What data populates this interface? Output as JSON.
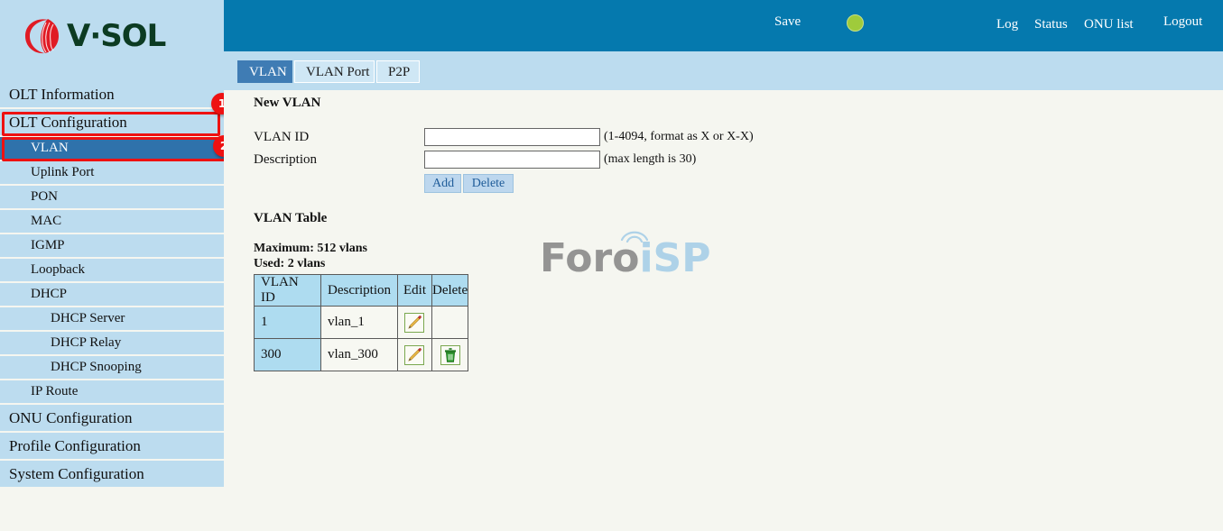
{
  "brand": {
    "logo_text": "V·SOL",
    "logo_mark_icon": "vsol-swoosh-icon",
    "logo_mark_color": "#e01b24",
    "logo_text_color": "#0c3b22"
  },
  "topbar": {
    "background_color": "#0579ae",
    "save_label": "Save",
    "status_dot_color": "#9fcb3b",
    "log_label": "Log",
    "status_label": "Status",
    "onu_list_label": "ONU list",
    "logout_label": "Logout"
  },
  "tabs": [
    {
      "label": "VLAN",
      "active": true
    },
    {
      "label": "VLAN Port",
      "active": false
    },
    {
      "label": "P2P",
      "active": false
    }
  ],
  "sidebar": {
    "items": [
      {
        "label": "OLT Information",
        "level": 0,
        "selected": false
      },
      {
        "label": "OLT Configuration",
        "level": 0,
        "selected": false
      },
      {
        "label": "VLAN",
        "level": 1,
        "selected": true
      },
      {
        "label": "Uplink Port",
        "level": 1,
        "selected": false
      },
      {
        "label": "PON",
        "level": 1,
        "selected": false
      },
      {
        "label": "MAC",
        "level": 1,
        "selected": false
      },
      {
        "label": "IGMP",
        "level": 1,
        "selected": false
      },
      {
        "label": "Loopback",
        "level": 1,
        "selected": false
      },
      {
        "label": "DHCP",
        "level": 1,
        "selected": false
      },
      {
        "label": "DHCP Server",
        "level": 2,
        "selected": false
      },
      {
        "label": "DHCP Relay",
        "level": 2,
        "selected": false
      },
      {
        "label": "DHCP Snooping",
        "level": 2,
        "selected": false
      },
      {
        "label": "IP Route",
        "level": 1,
        "selected": false
      },
      {
        "label": "ONU Configuration",
        "level": 0,
        "selected": false
      },
      {
        "label": "Profile Configuration",
        "level": 0,
        "selected": false
      },
      {
        "label": "System Configuration",
        "level": 0,
        "selected": false
      }
    ]
  },
  "annotations": {
    "color": "#ee1111",
    "badges": [
      {
        "number": "1",
        "target": "OLT Configuration"
      },
      {
        "number": "2",
        "target": "VLAN"
      }
    ]
  },
  "main": {
    "new_vlan": {
      "title": "New VLAN",
      "vlan_id_label": "VLAN ID",
      "vlan_id_value": "",
      "vlan_id_hint": "(1-4094, format as X or X-X)",
      "description_label": "Description",
      "description_value": "",
      "description_hint": "(max length is 30)",
      "add_label": "Add",
      "delete_label": "Delete"
    },
    "vlan_table": {
      "title": "VLAN Table",
      "maximum_line": "Maximum: 512 vlans",
      "used_line": "Used: 2 vlans",
      "columns": [
        "VLAN ID",
        "Description",
        "Edit",
        "Delete"
      ],
      "rows": [
        {
          "vlan_id": "1",
          "description": "vlan_1",
          "edit_icon": "pencil-edit-icon",
          "delete_icon": ""
        },
        {
          "vlan_id": "300",
          "description": "vlan_300",
          "edit_icon": "pencil-edit-icon",
          "delete_icon": "trash-delete-icon"
        }
      ]
    }
  },
  "watermark": {
    "part_one": "Foro",
    "part_two": "iSP",
    "part_one_color": "#8c8c8c",
    "part_two_color": "#a8cfe8"
  }
}
